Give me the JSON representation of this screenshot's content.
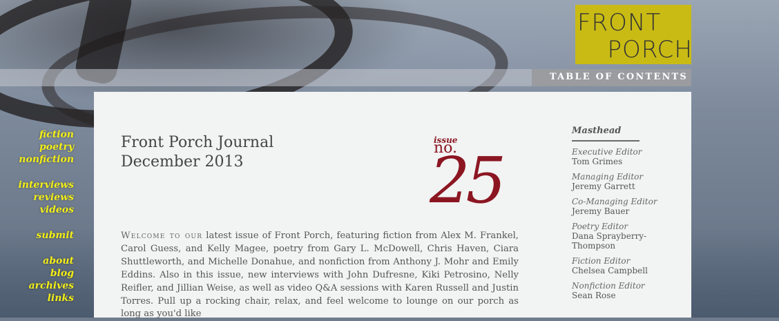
{
  "logo": {
    "line1": "FRONT",
    "line2": "PORCH"
  },
  "header": {
    "toc_label": "TABLE OF CONTENTS"
  },
  "nav": {
    "group1": [
      "fiction",
      "poetry",
      "nonfiction"
    ],
    "group2": [
      "interviews",
      "reviews",
      "videos"
    ],
    "group3": [
      "submit"
    ],
    "group4": [
      "about",
      "blog",
      "archives",
      "links"
    ]
  },
  "main": {
    "title_line1": "Front Porch Journal",
    "title_line2": "December 2013",
    "issue_word": "issue",
    "issue_no": "no.",
    "issue_number": "25",
    "intro_lead": "Welcome to our",
    "intro_text": "latest issue of Front Porch, featuring fiction from Alex M. Frankel, Carol Guess, and Kelly Magee, poetry from Gary L. McDowell, Chris Haven, Ciara Shuttleworth, and Michelle Donahue, and nonfiction from Anthony J. Mohr and Emily Eddins. Also in this issue, new interviews with John Dufresne, Kiki Petrosino, Nelly Reifler, and Jillian Weise, as well as video Q&A sessions with Karen Russell and Justin Torres. Pull up a rocking chair, relax, and feel welcome to lounge on our porch as long as you'd like"
  },
  "masthead": {
    "title": "Masthead",
    "entries": [
      {
        "role": "Executive Editor",
        "name": "Tom Grimes"
      },
      {
        "role": "Managing Editor",
        "name": "Jeremy Garrett"
      },
      {
        "role": "Co-Managing Editor",
        "name": "Jeremy Bauer"
      },
      {
        "role": "Poetry Editor",
        "name": "Dana Sprayberry-Thompson"
      },
      {
        "role": "Fiction Editor",
        "name": "Chelsea Campbell"
      },
      {
        "role": "Nonfiction Editor",
        "name": "Sean Rose"
      }
    ]
  },
  "colors": {
    "accent_yellow": "#f3ef17",
    "logo_bg": "#c9bb14",
    "issue_red": "#8b1622"
  }
}
